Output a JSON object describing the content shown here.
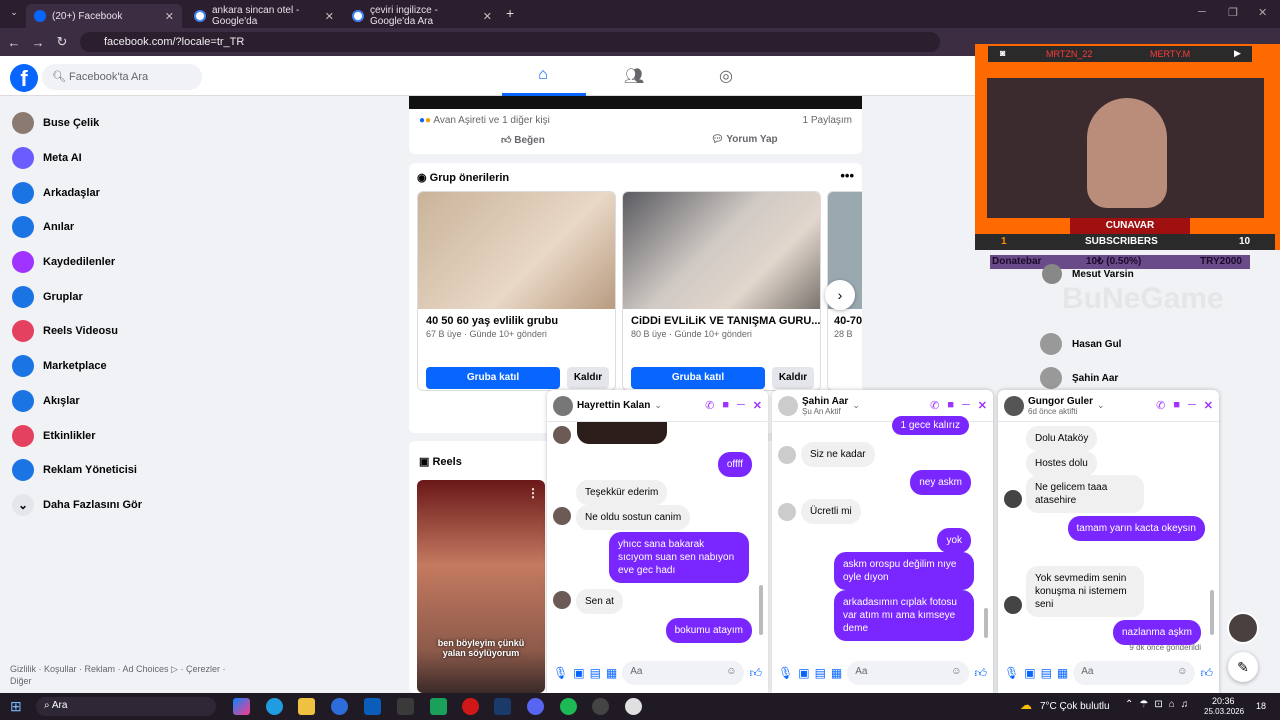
{
  "browser": {
    "tabs": [
      {
        "label": "(20+) Facebook"
      },
      {
        "label": "ankara sincan otel - Google'da"
      },
      {
        "label": "çeviri ingilizce - Google'da Ara"
      }
    ],
    "url": "facebook.com/?locale=tr_TR"
  },
  "fb": {
    "search_placeholder": "Facebook'ta Ara",
    "sidebar": [
      {
        "label": "Buse Çelik",
        "icon": "avatar-icon",
        "color": "#8a7a70"
      },
      {
        "label": "Meta AI",
        "icon": "meta-ai-icon",
        "color": "#6b5cff"
      },
      {
        "label": "Arkadaşlar",
        "icon": "friends-icon",
        "color": "#1b74e4"
      },
      {
        "label": "Anılar",
        "icon": "memories-icon",
        "color": "#1b74e4"
      },
      {
        "label": "Kaydedilenler",
        "icon": "bookmark-icon",
        "color": "#a033ff"
      },
      {
        "label": "Gruplar",
        "icon": "groups-icon",
        "color": "#1b74e4"
      },
      {
        "label": "Reels Videosu",
        "icon": "reels-icon",
        "color": "#e4405f"
      },
      {
        "label": "Marketplace",
        "icon": "marketplace-icon",
        "color": "#1b74e4"
      },
      {
        "label": "Akışlar",
        "icon": "feeds-icon",
        "color": "#1b74e4"
      },
      {
        "label": "Etkinlikler",
        "icon": "events-icon",
        "color": "#e4405f"
      },
      {
        "label": "Reklam Yöneticisi",
        "icon": "ads-manager-icon",
        "color": "#1b74e4"
      },
      {
        "label": "Daha Fazlasını Gör",
        "icon": "chevron-down-icon",
        "color": "#e4e6eb"
      }
    ],
    "footer": "Gizlilik · Koşullar · Reklam · Ad Choices ▷ · Çerezler · Diğer",
    "post": {
      "reactions": "Avan Aşireti ve 1 diğer kişi",
      "shares": "1 Paylaşım",
      "like_label": "Beğen",
      "comment_label": "Yorum Yap"
    },
    "groups": {
      "title": "Grup önerilerin",
      "join_label": "Gruba katıl",
      "remove_label": "Kaldır",
      "items": [
        {
          "name": "40 50 60 yaş evlilik grubu",
          "meta": "67 B üye · Günde 10+ gönderi"
        },
        {
          "name": "CiDDi EVLiLiK VE TANIŞMA GURU...",
          "meta": "80 B üye · Günde 10+ gönderi"
        },
        {
          "name": "40-70",
          "meta": "28 B"
        }
      ]
    },
    "reels": {
      "title": "Reels",
      "caption": "ben böyleyim çünkü yalan söylüyorum"
    },
    "contacts": [
      "Mesut Varsin",
      "Hasan Gul",
      "Şahin Aar"
    ]
  },
  "overlay": {
    "left_handle": "MRTZN_22",
    "right_handle": "MERTY.M",
    "name": "CUNAVAR",
    "subscribers_label": "SUBSCRIBERS",
    "sub_left": "1",
    "sub_right": "10",
    "donate_label": "Donatebar",
    "donate_amount": "10₺ (0.50%)",
    "donate_goal": "TRY2000",
    "watermark": "BuNeGame"
  },
  "chats": [
    {
      "name": "Hayrettin Kalan",
      "sub": "",
      "messages": [
        {
          "dir": "out",
          "text": "offff"
        },
        {
          "dir": "in",
          "text": "Teşekkür ederim"
        },
        {
          "dir": "in",
          "text": "Ne oldu sostun canim"
        },
        {
          "dir": "out",
          "text": "yhıcc sana bakarak sıcıyom suan sen nabıyon eve gec hadı"
        },
        {
          "dir": "in",
          "text": "Sen at"
        },
        {
          "dir": "out",
          "text": "bokumu atayım"
        }
      ],
      "input_placeholder": "Aa"
    },
    {
      "name": "Şahin Aar",
      "sub": "Şu An Aktif",
      "messages": [
        {
          "dir": "out",
          "text": "1 gece kalırız"
        },
        {
          "dir": "in",
          "text": "Siz ne kadar"
        },
        {
          "dir": "out",
          "text": "ney askm"
        },
        {
          "dir": "in",
          "text": "Ücretli mi"
        },
        {
          "dir": "out",
          "text": "yok"
        },
        {
          "dir": "out",
          "text": "askm orospu değilim nıye oyle dıyon"
        },
        {
          "dir": "out",
          "text": "arkadasımın cıplak fotosu var atım mı ama kımseye deme"
        }
      ],
      "input_placeholder": "Aa"
    },
    {
      "name": "Gungor Guler",
      "sub": "6d önce aktifti",
      "messages": [
        {
          "dir": "in",
          "text": "Dolu Ataköy"
        },
        {
          "dir": "in",
          "text": "Hostes dolu"
        },
        {
          "dir": "in",
          "text": "Ne gelicem taaa atasehire"
        },
        {
          "dir": "out",
          "text": "tamam yarın kacta okeysın"
        },
        {
          "dir": "in",
          "text": "Yok sevmedim senin konuşma ni istemem seni"
        },
        {
          "dir": "out",
          "text": "nazlanma aşkm"
        }
      ],
      "status": "9 dk önce gönderildi",
      "input_placeholder": "Aa"
    }
  ],
  "taskbar": {
    "search": "Ara",
    "weather": "7°C  Çok bulutlu",
    "time": "20:36",
    "date": "25.03.2026",
    "notif": "18"
  }
}
